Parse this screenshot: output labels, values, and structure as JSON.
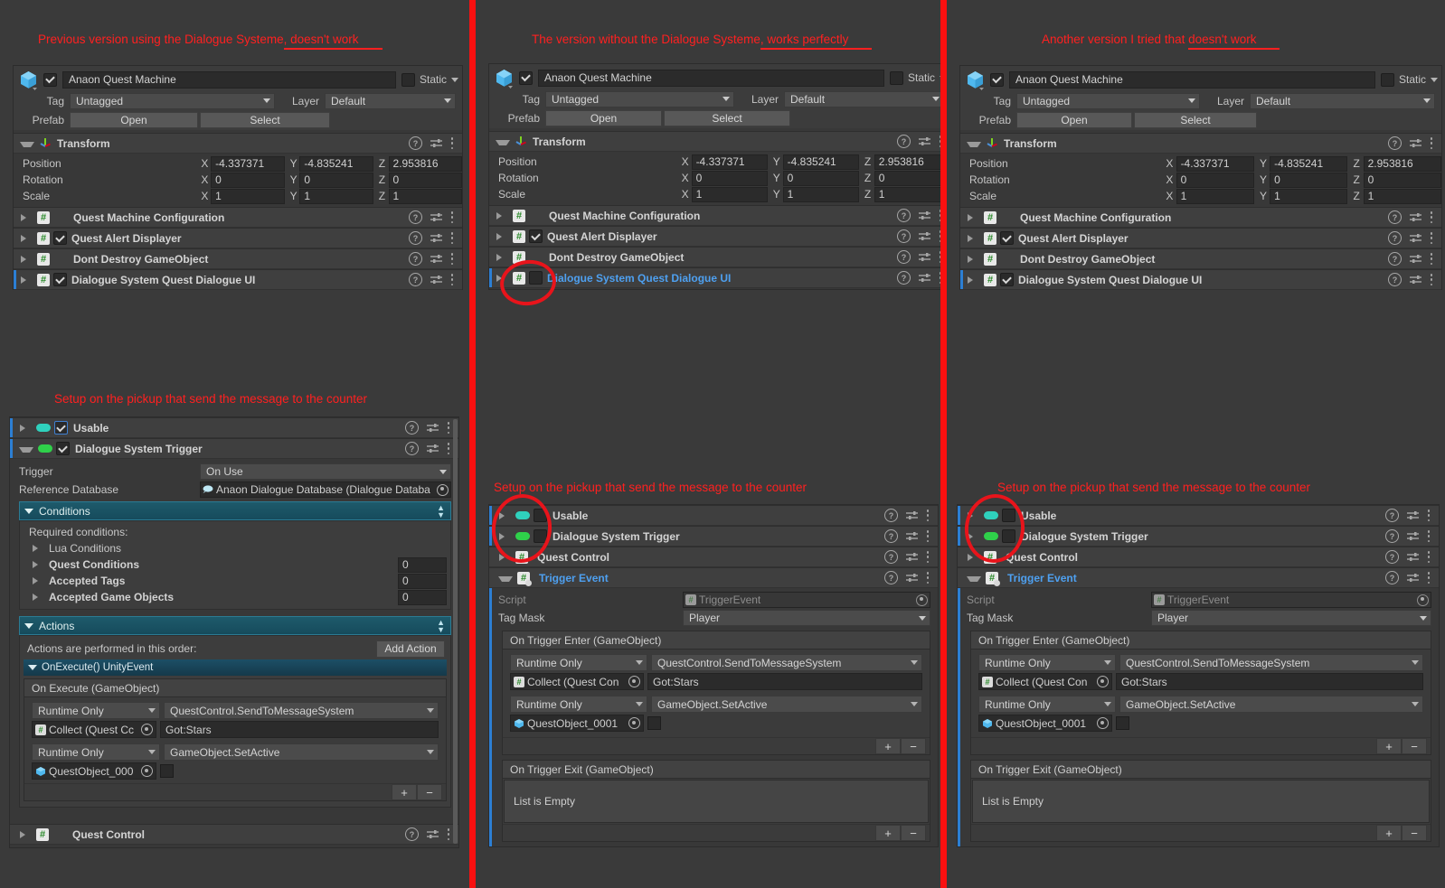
{
  "annotations": {
    "note1_plain": "Previous version using the Dialogue Systeme",
    "note1_underlined": ", doesn't work",
    "note2_plain": "The version without the Dialogue Systeme",
    "note2_underlined": ", works perfectly",
    "note3_plain": "Another version I tried that ",
    "note3_underlined": "doesn't work",
    "pickup_note": "Setup on the pickup that send the message to the counter"
  },
  "header": {
    "object_name": "Anaon Quest Machine",
    "static_label": "Static",
    "tag_label": "Tag",
    "tag_value": "Untagged",
    "layer_label": "Layer",
    "layer_value": "Default",
    "prefab_label": "Prefab",
    "open_button": "Open",
    "select_button": "Select"
  },
  "transform": {
    "title": "Transform",
    "rows": [
      {
        "label": "Position",
        "x": "-4.337371",
        "y": "-4.835241",
        "z": "2.953816"
      },
      {
        "label": "Rotation",
        "x": "0",
        "y": "0",
        "z": "0"
      },
      {
        "label": "Scale",
        "x": "1",
        "y": "1",
        "z": "1"
      }
    ],
    "axis_x": "X",
    "axis_y": "Y",
    "axis_z": "Z"
  },
  "components_top": [
    {
      "name": "Quest Machine Configuration",
      "checkbox": "none",
      "selected": false,
      "blue": false
    },
    {
      "name": "Quest Alert Displayer",
      "checkbox": "checked",
      "selected": false,
      "blue": false
    },
    {
      "name": "Dont Destroy GameObject",
      "checkbox": "none",
      "selected": false,
      "blue": false
    },
    {
      "name": "Dialogue System Quest Dialogue UI",
      "checkbox": "checked",
      "selected": true,
      "blue": false
    }
  ],
  "components_top_p2": [
    {
      "name": "Quest Machine Configuration",
      "checkbox": "none",
      "selected": false,
      "blue": false
    },
    {
      "name": "Quest Alert Displayer",
      "checkbox": "checked",
      "selected": false,
      "blue": false
    },
    {
      "name": "Dont Destroy GameObject",
      "checkbox": "none",
      "selected": false,
      "blue": false
    },
    {
      "name": "Dialogue System Quest Dialogue UI",
      "checkbox": "unchecked",
      "selected": true,
      "blue": true
    }
  ],
  "panel1": {
    "usable": "Usable",
    "dst": "Dialogue System Trigger",
    "trigger_label": "Trigger",
    "trigger_value": "On Use",
    "refdb_label": "Reference Database",
    "refdb_value": "Anaon Dialogue Database (Dialogue Databa",
    "conditions_header": "Conditions",
    "required_conditions": "Required conditions:",
    "lua_conditions": "Lua Conditions",
    "quest_conditions": "Quest Conditions",
    "accepted_tags": "Accepted Tags",
    "accepted_gameobjects": "Accepted Game Objects",
    "zero": "0",
    "actions_header": "Actions",
    "actions_order": "Actions are performed in this order:",
    "add_action": "Add Action",
    "unityevent_header": "OnExecute() UnityEvent",
    "onexecute_title": "On Execute (GameObject)",
    "runtime_only": "Runtime Only",
    "fn1": "QuestControl.SendToMessageSystem",
    "obj1": "Collect (Quest Cc",
    "arg1": "Got:Stars",
    "fn2": "GameObject.SetActive",
    "obj2": "QuestObject_000",
    "quest_control": "Quest Control",
    "plus": "+",
    "minus": "−"
  },
  "trigger_event": {
    "usable": "Usable",
    "dst": "Dialogue System Trigger",
    "quest_control": "Quest Control",
    "title": "Trigger Event",
    "script_label": "Script",
    "script_value": "TriggerEvent",
    "tagmask_label": "Tag Mask",
    "tagmask_value": "Player",
    "enter_title": "On Trigger Enter (GameObject)",
    "runtime_only": "Runtime Only",
    "fn1": "QuestControl.SendToMessageSystem",
    "obj1": "Collect (Quest Con",
    "arg1": "Got:Stars",
    "fn2": "GameObject.SetActive",
    "obj2": "QuestObject_0001",
    "exit_title": "On Trigger Exit (GameObject)",
    "empty_text": "List is Empty",
    "plus": "+",
    "minus": "−"
  },
  "colors": {
    "annotation_red": "#ff2020",
    "divider_red": "#fa1010",
    "selection_blue": "#2c7fd4",
    "link_blue": "#4ea0f0",
    "fold_teal": "#1e5a6b"
  }
}
